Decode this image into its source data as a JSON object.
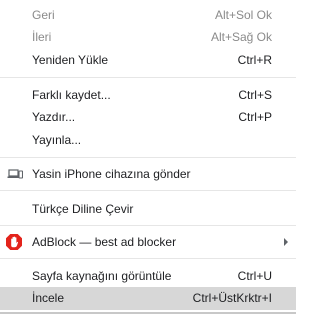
{
  "menu": {
    "back": {
      "label": "Geri",
      "shortcut": "Alt+Sol Ok"
    },
    "forward": {
      "label": "İleri",
      "shortcut": "Alt+Sağ Ok"
    },
    "reload": {
      "label": "Yeniden Yükle",
      "shortcut": "Ctrl+R"
    },
    "save_as": {
      "label": "Farklı kaydet...",
      "shortcut": "Ctrl+S"
    },
    "print": {
      "label": "Yazdır...",
      "shortcut": "Ctrl+P"
    },
    "cast": {
      "label": "Yayınla..."
    },
    "send_to_device": {
      "label": "Yasin iPhone cihazına gönder",
      "icon": "laptop-phone-icon"
    },
    "translate": {
      "label": "Türkçe Diline Çevir"
    },
    "adblock": {
      "label": "AdBlock — best ad blocker",
      "icon": "adblock-hand-icon",
      "icon_color": "#e3231b"
    },
    "view_source": {
      "label": "Sayfa kaynağını görüntüle",
      "shortcut": "Ctrl+U"
    },
    "inspect": {
      "label": "İncele",
      "shortcut": "Ctrl+ÜstKrktr+I"
    }
  }
}
